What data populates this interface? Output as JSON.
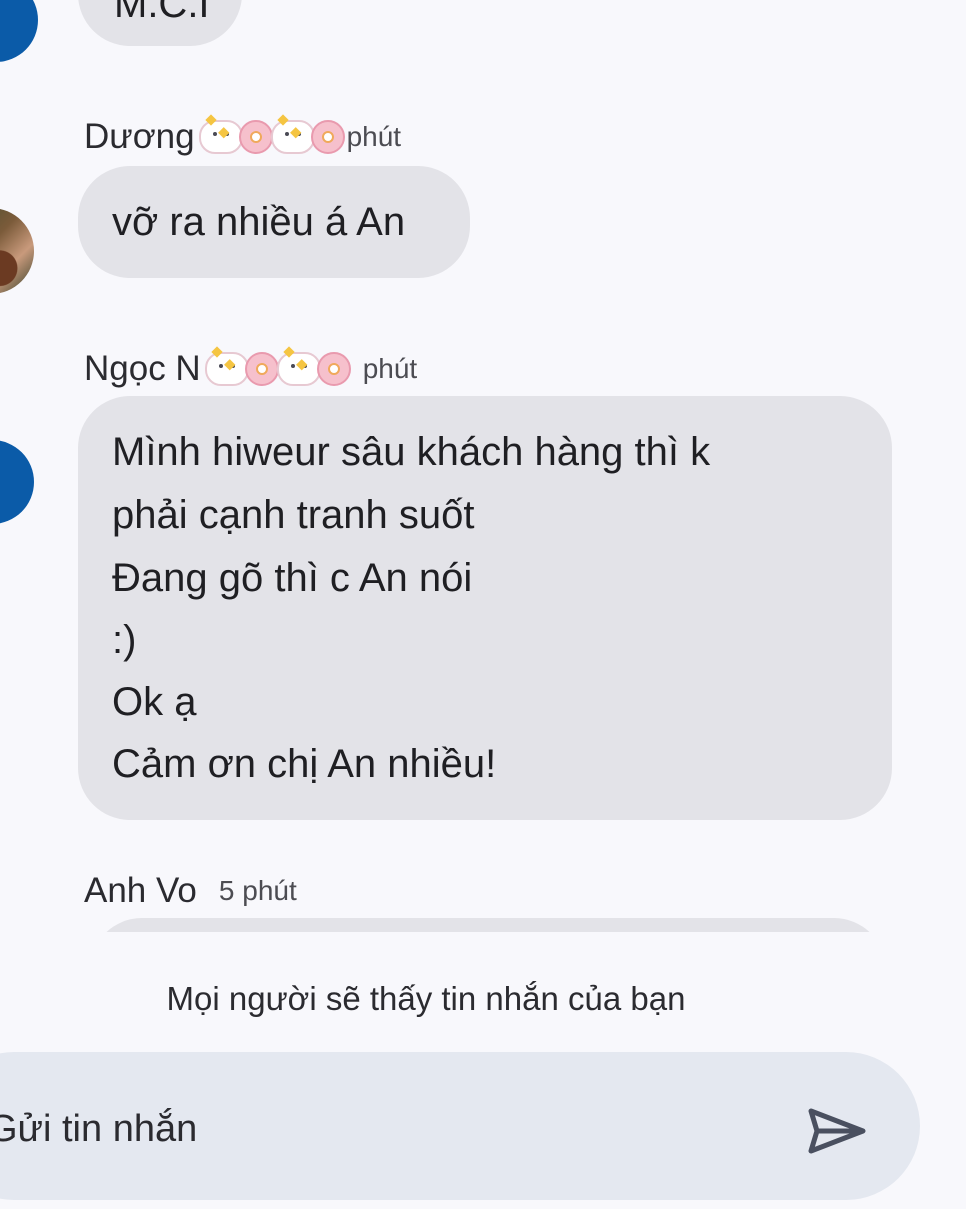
{
  "messages": [
    {
      "sender": "",
      "time": "",
      "text": "M.C.I"
    },
    {
      "sender": "Dương",
      "time": "phút",
      "text": "vỡ ra nhiều á An"
    },
    {
      "sender": "Ngọc N",
      "time": "phút",
      "lines": [
        "Mình hiweur sâu khách hàng thì k",
        "phải cạnh tranh suốt",
        "Đang gõ thì c An nói",
        ":)",
        "Ok ạ",
        "Cảm ơn chị An nhiều!"
      ]
    },
    {
      "sender": "Anh Vo",
      "time": "5 phút"
    }
  ],
  "notice": "Mọi người sẽ thấy tin nhắn của bạn",
  "composer": {
    "placeholder": "Gửi tin nhắn",
    "send_icon": "send-icon"
  },
  "colors": {
    "background": "#f8f8fc",
    "bubble": "#e3e3e8",
    "avatar_blue": "#0b5ba8",
    "composer": "#e4e8f0"
  }
}
